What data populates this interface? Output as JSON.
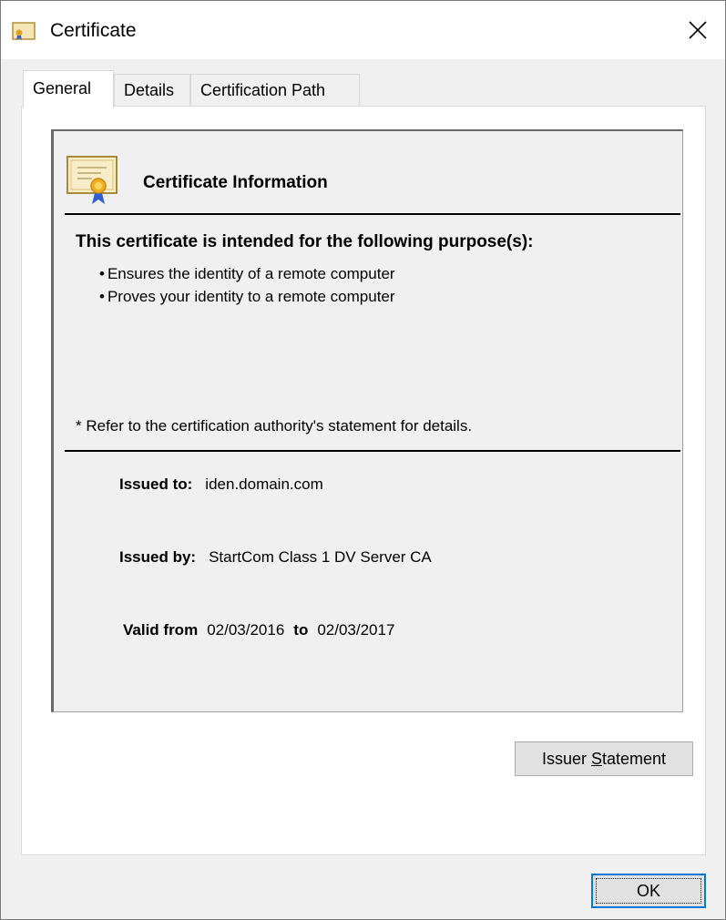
{
  "window": {
    "title": "Certificate",
    "close_icon": "close-icon"
  },
  "tabs": [
    {
      "label": "General",
      "active": true
    },
    {
      "label": "Details",
      "active": false
    },
    {
      "label": "Certification Path",
      "active": false
    }
  ],
  "general": {
    "info_title": "Certificate Information",
    "purpose_heading": "This certificate is intended for the following purpose(s):",
    "purposes": [
      "Ensures the identity of a remote computer",
      "Proves your identity to a remote computer"
    ],
    "note": "* Refer to the certification authority's statement for details.",
    "issued_to_label": "Issued to:",
    "issued_to_value": "iden.domain.com",
    "issued_by_label": "Issued by:",
    "issued_by_value": "StartCom Class 1 DV Server CA",
    "valid_from_label": "Valid from",
    "valid_from_value": "02/03/2016",
    "valid_to_label": "to",
    "valid_to_value": "02/03/2017"
  },
  "buttons": {
    "issuer_statement_pre": "Issuer ",
    "issuer_statement_underlined": "S",
    "issuer_statement_post": "tatement",
    "ok": "OK"
  },
  "colors": {
    "focus_border": "#0078d7",
    "panel_bg": "#ffffff",
    "window_bg": "#f0f0f0"
  }
}
